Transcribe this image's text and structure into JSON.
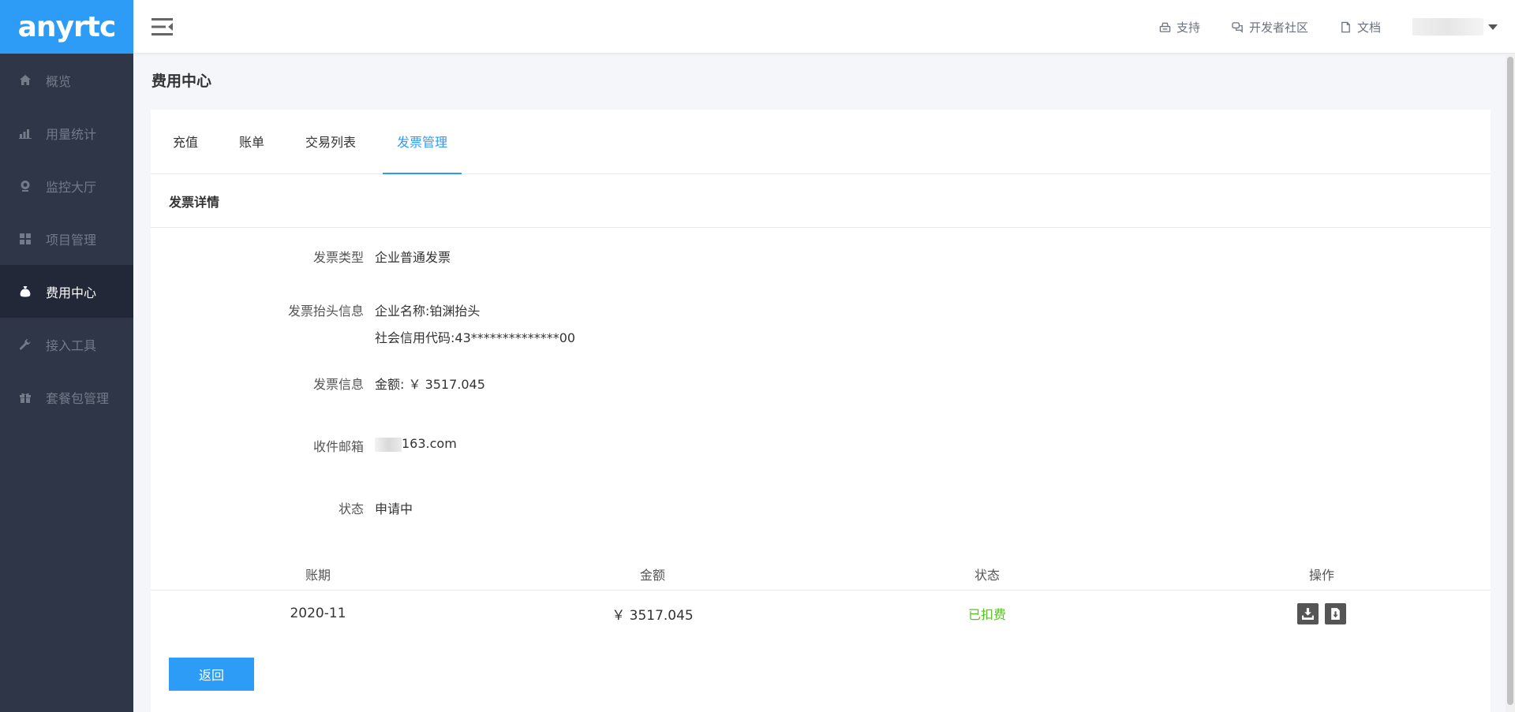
{
  "brand": {
    "logo_text": "anyrtc",
    "color": "#2d9cf7"
  },
  "sidebar": {
    "items": [
      {
        "label": "概览",
        "icon": "home-icon",
        "active": false
      },
      {
        "label": "用量统计",
        "icon": "bar-chart-icon",
        "active": false
      },
      {
        "label": "监控大厅",
        "icon": "webcam-icon",
        "active": false
      },
      {
        "label": "项目管理",
        "icon": "grid-icon",
        "active": false
      },
      {
        "label": "费用中心",
        "icon": "money-bag-icon",
        "active": true
      },
      {
        "label": "接入工具",
        "icon": "wrench-icon",
        "active": false
      },
      {
        "label": "套餐包管理",
        "icon": "gift-icon",
        "active": false
      }
    ]
  },
  "header": {
    "links": [
      {
        "label": "支持",
        "icon": "support-icon"
      },
      {
        "label": "开发者社区",
        "icon": "chat-icon"
      },
      {
        "label": "文档",
        "icon": "document-icon"
      }
    ]
  },
  "page": {
    "title": "费用中心"
  },
  "tabs": [
    {
      "label": "充值",
      "active": false
    },
    {
      "label": "账单",
      "active": false
    },
    {
      "label": "交易列表",
      "active": false
    },
    {
      "label": "发票管理",
      "active": true
    }
  ],
  "invoice": {
    "section_title": "发票详情",
    "type_label": "发票类型",
    "type_value": "企业普通发票",
    "header_label": "发票抬头信息",
    "company_name": "企业名称:铂渊抬头",
    "credit_code": "社会信用代码:43**************00",
    "info_label": "发票信息",
    "amount_text": "金额: ￥ 3517.045",
    "email_label": "收件邮箱",
    "email_value": "163.com",
    "status_label": "状态",
    "status_value": "申请中",
    "status_color": "#f5a623"
  },
  "table": {
    "headers": [
      "账期",
      "金额",
      "状态",
      "操作"
    ],
    "rows": [
      {
        "period": "2020-11",
        "amount": "￥ 3517.045",
        "status": "已扣费",
        "status_color": "#52c41a"
      }
    ]
  },
  "buttons": {
    "back": "返回"
  }
}
